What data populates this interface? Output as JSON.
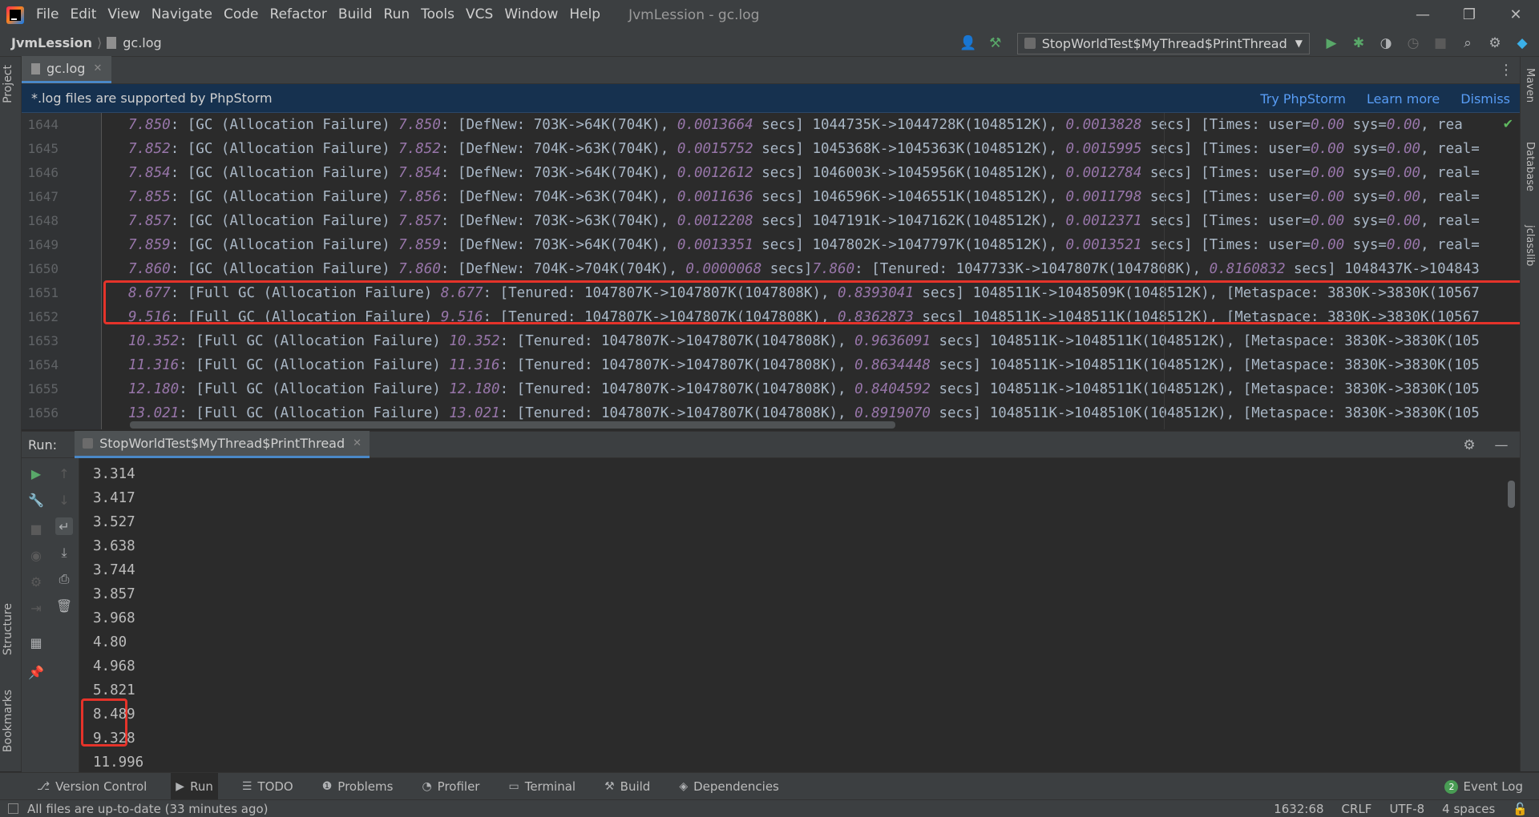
{
  "menu": [
    "File",
    "Edit",
    "View",
    "Navigate",
    "Code",
    "Refactor",
    "Build",
    "Run",
    "Tools",
    "VCS",
    "Window",
    "Help"
  ],
  "window_title": "JvmLession - gc.log",
  "window_controls": {
    "minimize": "—",
    "restore": "❐",
    "close": "✕"
  },
  "breadcrumb": {
    "project": "JvmLession",
    "file": "gc.log"
  },
  "run_config": {
    "name": "StopWorldTest$MyThread$PrintThread"
  },
  "left_strip": {
    "project": "Project",
    "structure": "Structure",
    "bookmarks": "Bookmarks"
  },
  "right_strip": {
    "maven": "Maven",
    "database": "Database",
    "jclasslib": "jclasslib"
  },
  "editor_tab": {
    "label": "gc.log"
  },
  "banner": {
    "message": "*.log files are supported by PhpStorm",
    "try": "Try PhpStorm",
    "learn": "Learn more",
    "dismiss": "Dismiss"
  },
  "editor": {
    "lines": [
      {
        "num": "1644",
        "parts": [
          {
            "t": "7.850",
            "i": true
          },
          {
            "t": ": [GC (Allocation Failure) "
          },
          {
            "t": "7.850",
            "i": true
          },
          {
            "t": ": [DefNew: 703K->64K(704K), "
          },
          {
            "t": "0.0013664",
            "i": true
          },
          {
            "t": " secs] 1044735K->1044728K(1048512K), "
          },
          {
            "t": "0.0013828",
            "i": true
          },
          {
            "t": " secs] [Times: user="
          },
          {
            "t": "0.00",
            "i": true
          },
          {
            "t": " sys="
          },
          {
            "t": "0.00",
            "i": true
          },
          {
            "t": ", rea"
          }
        ]
      },
      {
        "num": "1645",
        "parts": [
          {
            "t": "7.852",
            "i": true
          },
          {
            "t": ": [GC (Allocation Failure) "
          },
          {
            "t": "7.852",
            "i": true
          },
          {
            "t": ": [DefNew: 704K->63K(704K), "
          },
          {
            "t": "0.0015752",
            "i": true
          },
          {
            "t": " secs] 1045368K->1045363K(1048512K), "
          },
          {
            "t": "0.0015995",
            "i": true
          },
          {
            "t": " secs] [Times: user="
          },
          {
            "t": "0.00",
            "i": true
          },
          {
            "t": " sys="
          },
          {
            "t": "0.00",
            "i": true
          },
          {
            "t": ", real="
          }
        ]
      },
      {
        "num": "1646",
        "parts": [
          {
            "t": "7.854",
            "i": true
          },
          {
            "t": ": [GC (Allocation Failure) "
          },
          {
            "t": "7.854",
            "i": true
          },
          {
            "t": ": [DefNew: 703K->64K(704K), "
          },
          {
            "t": "0.0012612",
            "i": true
          },
          {
            "t": " secs] 1046003K->1045956K(1048512K), "
          },
          {
            "t": "0.0012784",
            "i": true
          },
          {
            "t": " secs] [Times: user="
          },
          {
            "t": "0.00",
            "i": true
          },
          {
            "t": " sys="
          },
          {
            "t": "0.00",
            "i": true
          },
          {
            "t": ", real="
          }
        ]
      },
      {
        "num": "1647",
        "parts": [
          {
            "t": "7.855",
            "i": true
          },
          {
            "t": ": [GC (Allocation Failure) "
          },
          {
            "t": "7.856",
            "i": true
          },
          {
            "t": ": [DefNew: 704K->63K(704K), "
          },
          {
            "t": "0.0011636",
            "i": true
          },
          {
            "t": " secs] 1046596K->1046551K(1048512K), "
          },
          {
            "t": "0.0011798",
            "i": true
          },
          {
            "t": " secs] [Times: user="
          },
          {
            "t": "0.00",
            "i": true
          },
          {
            "t": " sys="
          },
          {
            "t": "0.00",
            "i": true
          },
          {
            "t": ", real="
          }
        ]
      },
      {
        "num": "1648",
        "parts": [
          {
            "t": "7.857",
            "i": true
          },
          {
            "t": ": [GC (Allocation Failure) "
          },
          {
            "t": "7.857",
            "i": true
          },
          {
            "t": ": [DefNew: 703K->63K(704K), "
          },
          {
            "t": "0.0012208",
            "i": true
          },
          {
            "t": " secs] 1047191K->1047162K(1048512K), "
          },
          {
            "t": "0.0012371",
            "i": true
          },
          {
            "t": " secs] [Times: user="
          },
          {
            "t": "0.00",
            "i": true
          },
          {
            "t": " sys="
          },
          {
            "t": "0.00",
            "i": true
          },
          {
            "t": ", real="
          }
        ]
      },
      {
        "num": "1649",
        "parts": [
          {
            "t": "7.859",
            "i": true
          },
          {
            "t": ": [GC (Allocation Failure) "
          },
          {
            "t": "7.859",
            "i": true
          },
          {
            "t": ": [DefNew: 703K->64K(704K), "
          },
          {
            "t": "0.0013351",
            "i": true
          },
          {
            "t": " secs] 1047802K->1047797K(1048512K), "
          },
          {
            "t": "0.0013521",
            "i": true
          },
          {
            "t": " secs] [Times: user="
          },
          {
            "t": "0.00",
            "i": true
          },
          {
            "t": " sys="
          },
          {
            "t": "0.00",
            "i": true
          },
          {
            "t": ", real="
          }
        ]
      },
      {
        "num": "1650",
        "parts": [
          {
            "t": "7.860",
            "i": true
          },
          {
            "t": ": [GC (Allocation Failure) "
          },
          {
            "t": "7.860",
            "i": true
          },
          {
            "t": ": [DefNew: 704K->704K(704K), "
          },
          {
            "t": "0.0000068",
            "i": true
          },
          {
            "t": " secs]"
          },
          {
            "t": "7.860",
            "i": true
          },
          {
            "t": ": [Tenured: 1047733K->1047807K(1047808K), "
          },
          {
            "t": "0.8160832",
            "i": true
          },
          {
            "t": " secs] 1048437K->104843"
          }
        ]
      },
      {
        "num": "1651",
        "parts": [
          {
            "t": "8.677",
            "i": true
          },
          {
            "t": ": [Full GC (Allocation Failure) "
          },
          {
            "t": "8.677",
            "i": true
          },
          {
            "t": ": [Tenured: 1047807K->1047807K(1047808K), "
          },
          {
            "t": "0.8393041",
            "i": true
          },
          {
            "t": " secs] 1048511K->1048509K(1048512K), [Metaspace: 3830K->3830K(10567"
          }
        ]
      },
      {
        "num": "1652",
        "parts": [
          {
            "t": "9.516",
            "i": true
          },
          {
            "t": ": [Full GC (Allocation Failure) "
          },
          {
            "t": "9.516",
            "i": true
          },
          {
            "t": ": [Tenured: 1047807K->1047807K(1047808K), "
          },
          {
            "t": "0.8362873",
            "i": true
          },
          {
            "t": " secs] 1048511K->1048511K(1048512K), [Metaspace: 3830K->3830K(10567"
          }
        ]
      },
      {
        "num": "1653",
        "parts": [
          {
            "t": "10.352",
            "i": true
          },
          {
            "t": ": [Full GC (Allocation Failure) "
          },
          {
            "t": "10.352",
            "i": true
          },
          {
            "t": ": [Tenured: 1047807K->1047807K(1047808K), "
          },
          {
            "t": "0.9636091",
            "i": true
          },
          {
            "t": " secs] 1048511K->1048511K(1048512K), [Metaspace: 3830K->3830K(105"
          }
        ]
      },
      {
        "num": "1654",
        "parts": [
          {
            "t": "11.316",
            "i": true
          },
          {
            "t": ": [Full GC (Allocation Failure) "
          },
          {
            "t": "11.316",
            "i": true
          },
          {
            "t": ": [Tenured: 1047807K->1047807K(1047808K), "
          },
          {
            "t": "0.8634448",
            "i": true
          },
          {
            "t": " secs] 1048511K->1048511K(1048512K), [Metaspace: 3830K->3830K(105"
          }
        ]
      },
      {
        "num": "1655",
        "parts": [
          {
            "t": "12.180",
            "i": true
          },
          {
            "t": ": [Full GC (Allocation Failure) "
          },
          {
            "t": "12.180",
            "i": true
          },
          {
            "t": ": [Tenured: 1047807K->1047807K(1047808K), "
          },
          {
            "t": "0.8404592",
            "i": true
          },
          {
            "t": " secs] 1048511K->1048511K(1048512K), [Metaspace: 3830K->3830K(105"
          }
        ]
      },
      {
        "num": "1656",
        "parts": [
          {
            "t": "13.021",
            "i": true
          },
          {
            "t": ": [Full GC (Allocation Failure) "
          },
          {
            "t": "13.021",
            "i": true
          },
          {
            "t": ": [Tenured: 1047807K->1047807K(1047808K), "
          },
          {
            "t": "0.8919070",
            "i": true
          },
          {
            "t": " secs] 1048511K->1048510K(1048512K), [Metaspace: 3830K->3830K(105"
          }
        ]
      }
    ]
  },
  "run": {
    "label": "Run:",
    "tab": "StopWorldTest$MyThread$PrintThread",
    "output": [
      "3.314",
      "3.417",
      "3.527",
      "3.638",
      "3.744",
      "3.857",
      "3.968",
      "4.80",
      "4.968",
      "5.821",
      "8.489",
      "9.328",
      "11.996"
    ]
  },
  "toolbar": {
    "items": [
      {
        "icon": "⎇",
        "label": "Version Control"
      },
      {
        "icon": "▶",
        "label": "Run"
      },
      {
        "icon": "☰",
        "label": "TODO"
      },
      {
        "icon": "❶",
        "label": "Problems"
      },
      {
        "icon": "◔",
        "label": "Profiler"
      },
      {
        "icon": "▭",
        "label": "Terminal"
      },
      {
        "icon": "⚒",
        "label": "Build"
      },
      {
        "icon": "◈",
        "label": "Dependencies"
      }
    ],
    "event_log": "Event Log",
    "event_count": "2"
  },
  "status": {
    "message": "All files are up-to-date (33 minutes ago)",
    "position": "1632:68",
    "line_sep": "CRLF",
    "encoding": "UTF-8",
    "indent": "4 spaces"
  },
  "colors": {
    "highlight_box": "#e5332a",
    "accent": "#4a88c7",
    "number_italic": "#9876aa"
  }
}
